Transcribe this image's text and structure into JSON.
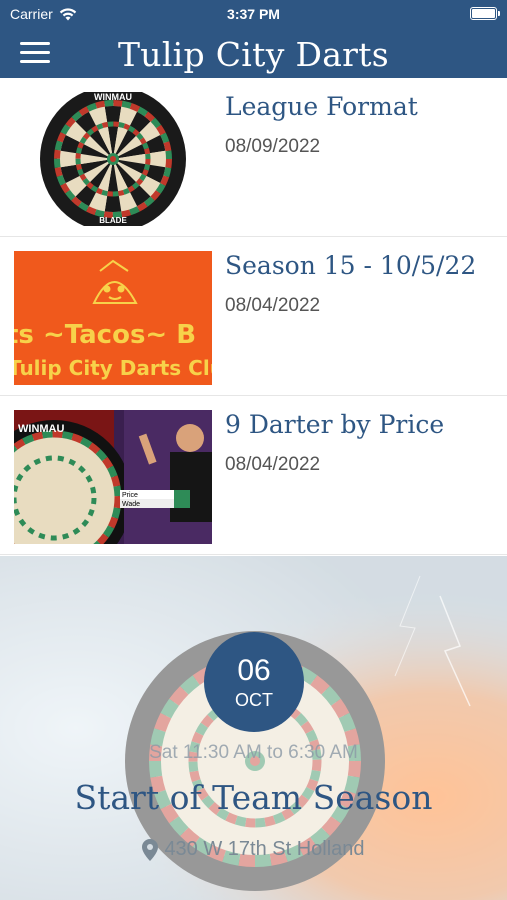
{
  "status_bar": {
    "carrier": "Carrier",
    "time": "3:37 PM"
  },
  "header": {
    "title": "Tulip City Darts",
    "menu_icon": "hamburger-menu-icon"
  },
  "posts": [
    {
      "title": "League Format",
      "date": "08/09/2022",
      "thumbnail": "dartboard-winmau-blade"
    },
    {
      "title": "Season 15 - 10/5/22",
      "date": "08/04/2022",
      "thumbnail": "tacos-banner",
      "thumb_text": {
        "line1": "ts ~Tacos~ B",
        "line2": "Tulip City Darts Club"
      }
    },
    {
      "title": "9 Darter by Price",
      "date": "08/04/2022",
      "thumbnail": "dart-match-broadcast",
      "thumb_text": {
        "brand": "WINMAU",
        "player1": "Price",
        "player2": "Wade"
      }
    }
  ],
  "event": {
    "day": "06",
    "month": "OCT",
    "time": "Sat 11:30 AM to 6:30 AM",
    "title": "Start of Team Season",
    "location": "430 W 17th St Holland",
    "location_icon": "map-pin-icon"
  },
  "colors": {
    "primary": "#2e5683",
    "date_text": "#555555",
    "taco_bg": "#f0591c",
    "taco_text": "#f7d24a"
  }
}
